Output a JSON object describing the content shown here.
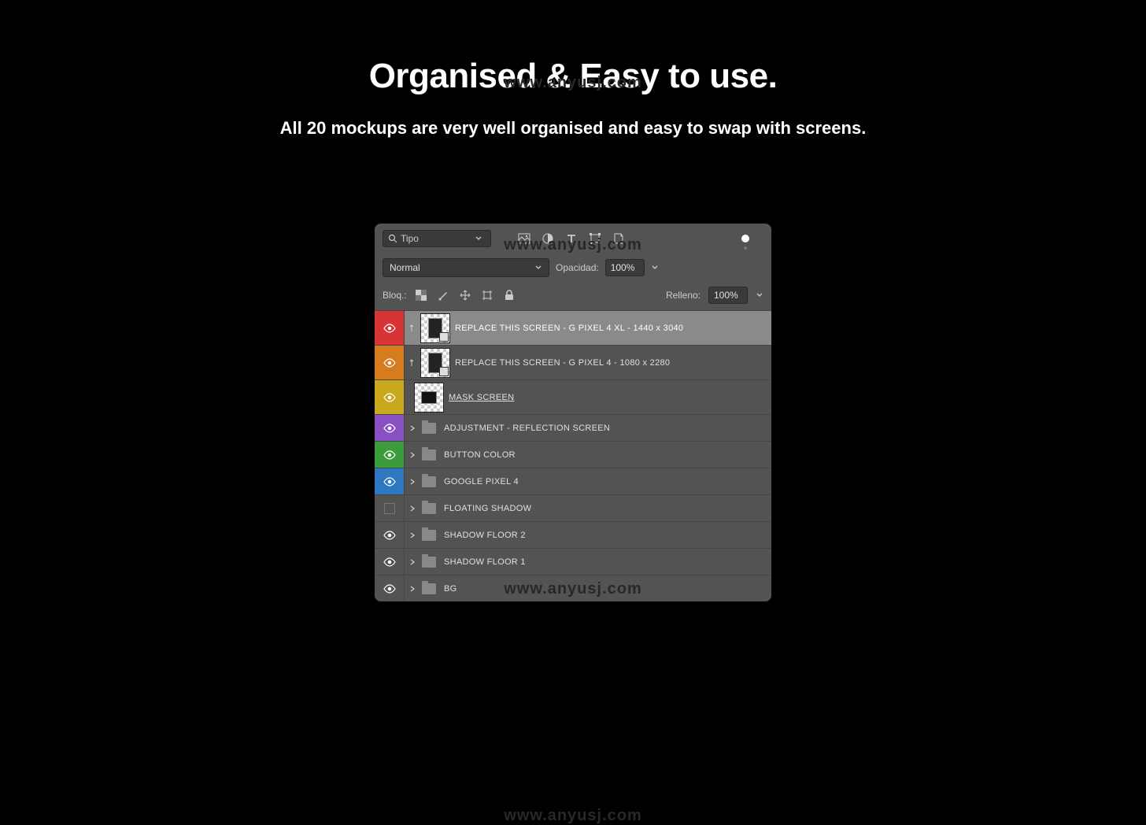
{
  "watermark": "www.anyusj.com",
  "heading": "Organised & Easy to use.",
  "subheading": "All 20 mockups are very well organised and easy to swap with screens.",
  "panel": {
    "search_label": "Tipo",
    "blend_mode": "Normal",
    "opacity_label": "Opacidad:",
    "opacity_value": "100%",
    "lock_label": "Bloq.:",
    "fill_label": "Relleno:",
    "fill_value": "100%"
  },
  "layers": [
    {
      "name": "REPLACE THIS SCREEN - G PIXEL 4 XL - 1440 x 3040",
      "type": "smart",
      "visible": true,
      "color": "red",
      "selected": true,
      "linked": true
    },
    {
      "name": "REPLACE THIS SCREEN - G PIXEL 4 - 1080 x 2280",
      "type": "smart",
      "visible": true,
      "color": "orange",
      "selected": false,
      "linked": true
    },
    {
      "name": "MASK SCREEN",
      "type": "mask",
      "visible": true,
      "color": "yellow",
      "selected": false,
      "underline": true
    },
    {
      "name": "ADJUSTMENT - REFLECTION SCREEN",
      "type": "group",
      "visible": true,
      "color": "purple",
      "selected": false
    },
    {
      "name": "BUTTON COLOR",
      "type": "group",
      "visible": true,
      "color": "green",
      "selected": false
    },
    {
      "name": "GOOGLE PIXEL 4",
      "type": "group",
      "visible": true,
      "color": "blue",
      "selected": false
    },
    {
      "name": "FLOATING SHADOW",
      "type": "group",
      "visible": false,
      "color": "none",
      "selected": false
    },
    {
      "name": "SHADOW FLOOR 2",
      "type": "group",
      "visible": true,
      "color": "none",
      "selected": false
    },
    {
      "name": "SHADOW FLOOR 1",
      "type": "group",
      "visible": true,
      "color": "none",
      "selected": false
    },
    {
      "name": "BG",
      "type": "group",
      "visible": true,
      "color": "none",
      "selected": false
    }
  ]
}
